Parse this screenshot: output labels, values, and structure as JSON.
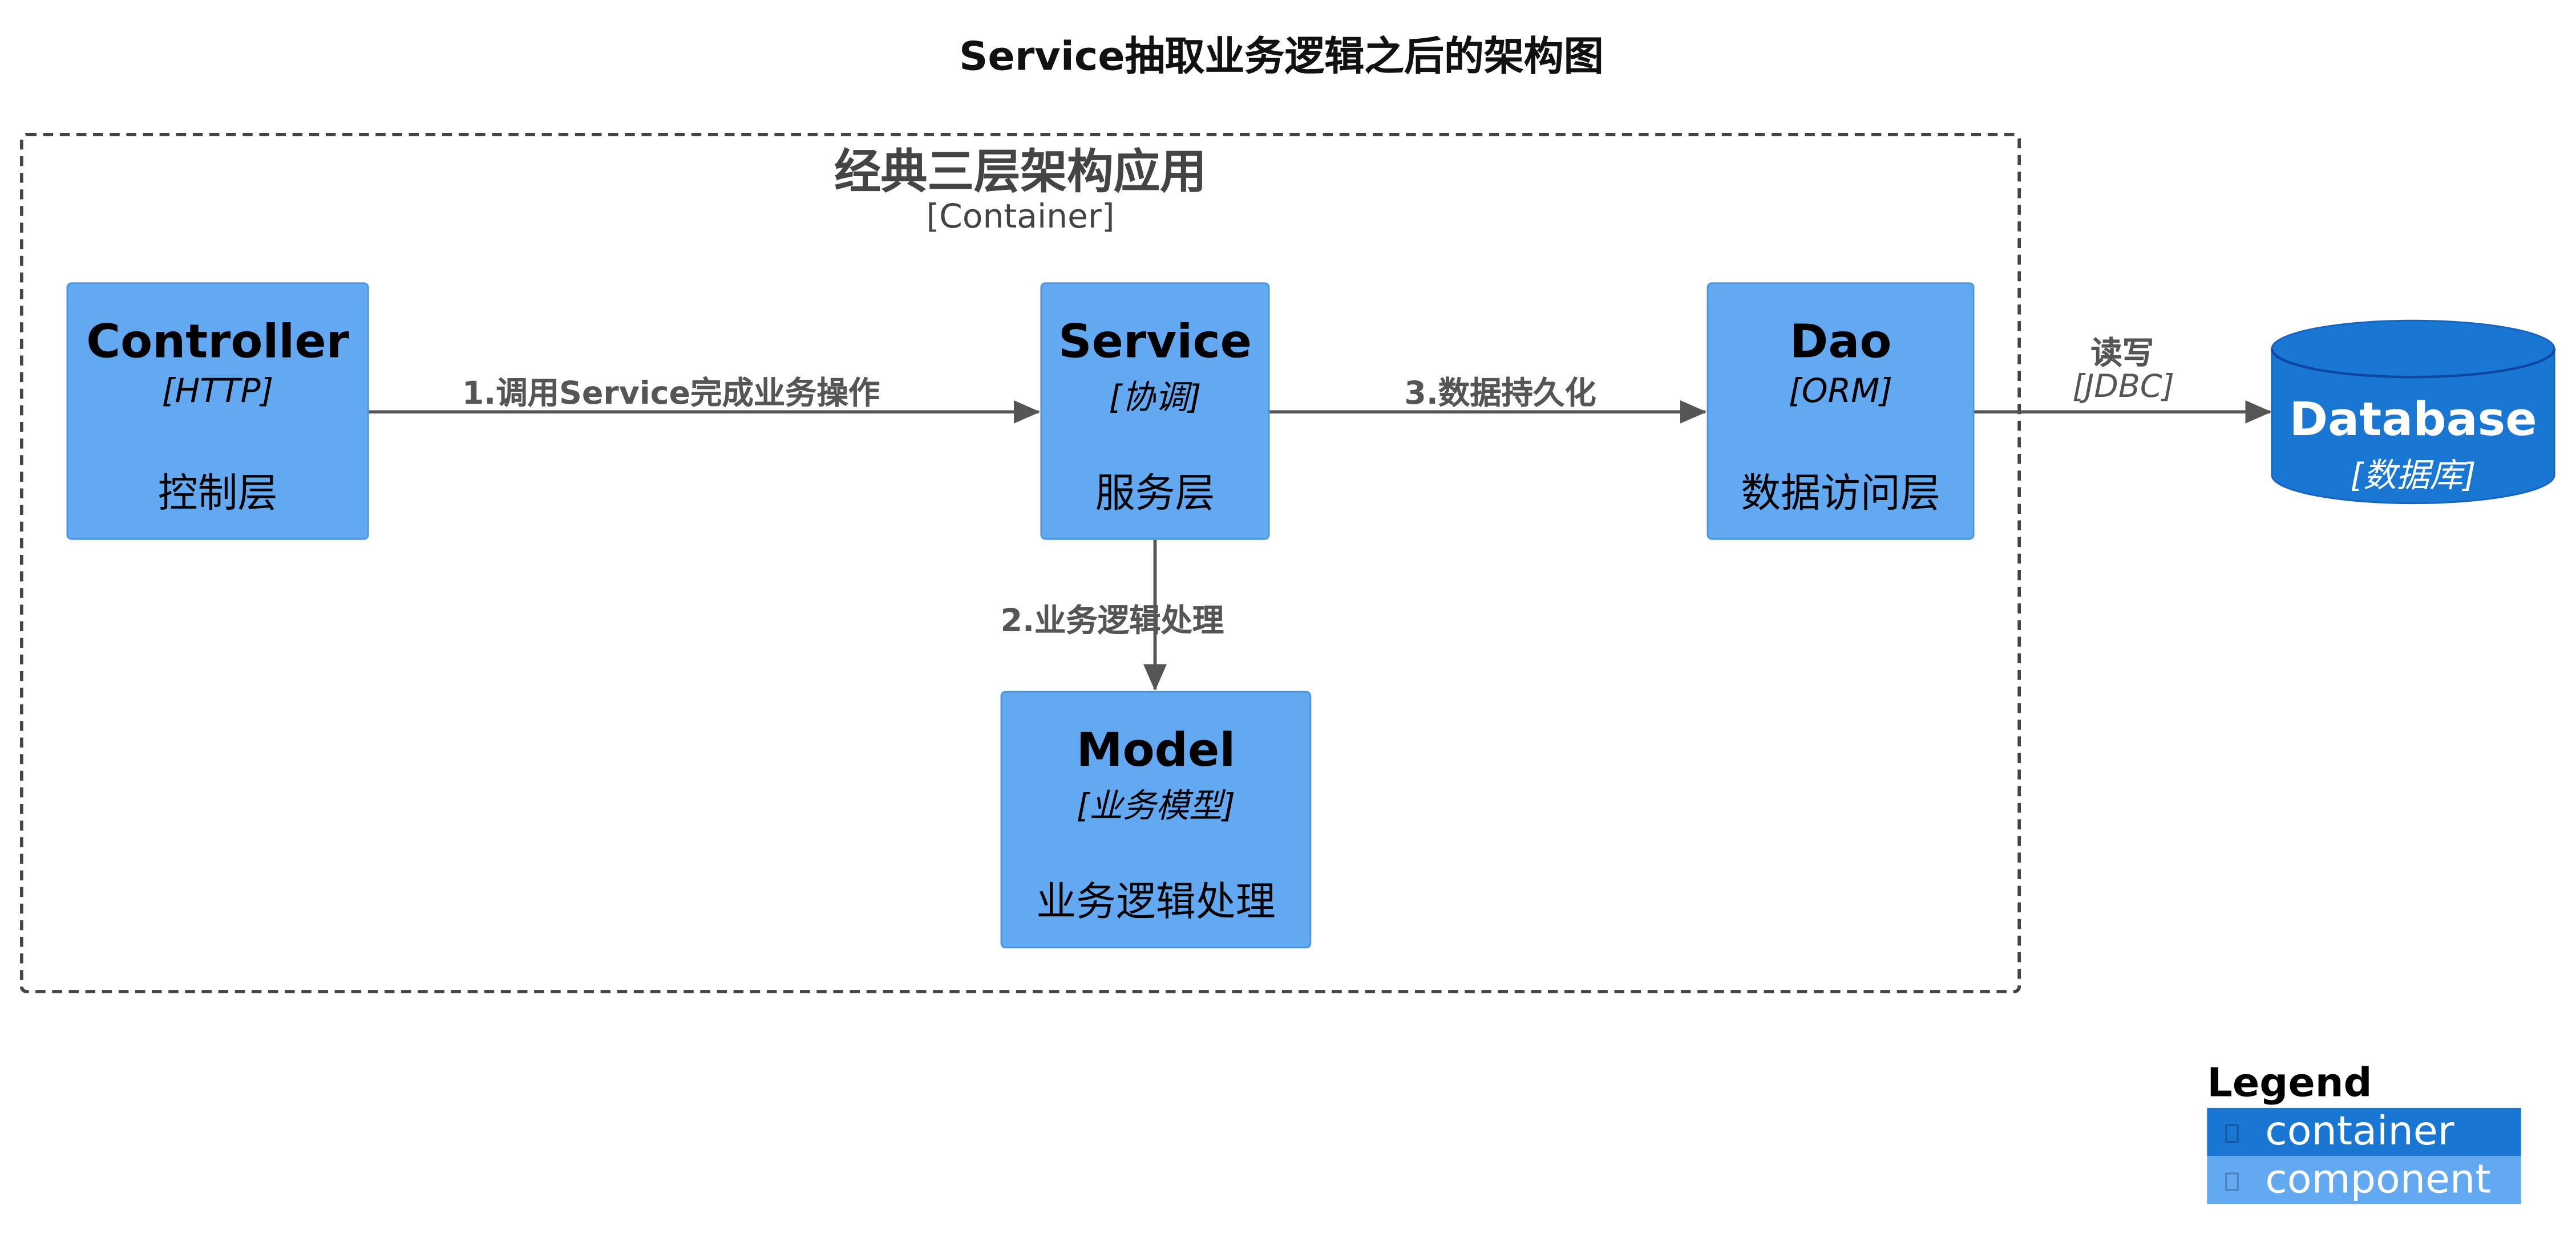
{
  "title": "Service抽取业务逻辑之后的架构图",
  "colors": {
    "component": "#63a9f2",
    "container": "#1976d2",
    "edge": "#555555",
    "boundary": "#444444"
  },
  "boundary": {
    "name": "经典三层架构应用",
    "type": "[Container]"
  },
  "nodes": {
    "controller": {
      "name": "Controller",
      "tech": "[HTTP]",
      "desc": "控制层"
    },
    "service": {
      "name": "Service",
      "tech": "[协调]",
      "desc": "服务层"
    },
    "dao": {
      "name": "Dao",
      "tech": "[ORM]",
      "desc": "数据访问层"
    },
    "model": {
      "name": "Model",
      "tech": "[业务模型]",
      "desc": "业务逻辑处理"
    },
    "database": {
      "name": "Database",
      "tech": "[数据库]"
    }
  },
  "edges": {
    "controller_service": {
      "label": "1.调用Service完成业务操作"
    },
    "service_model": {
      "label": "2.业务逻辑处理"
    },
    "service_dao": {
      "label": "3.数据持久化"
    },
    "dao_database": {
      "label": "读写",
      "tech": "[JDBC]"
    }
  },
  "legend": {
    "title": "Legend",
    "items": [
      {
        "label": "container",
        "color": "#1976d2"
      },
      {
        "label": "component",
        "color": "#63a9f2"
      }
    ]
  }
}
